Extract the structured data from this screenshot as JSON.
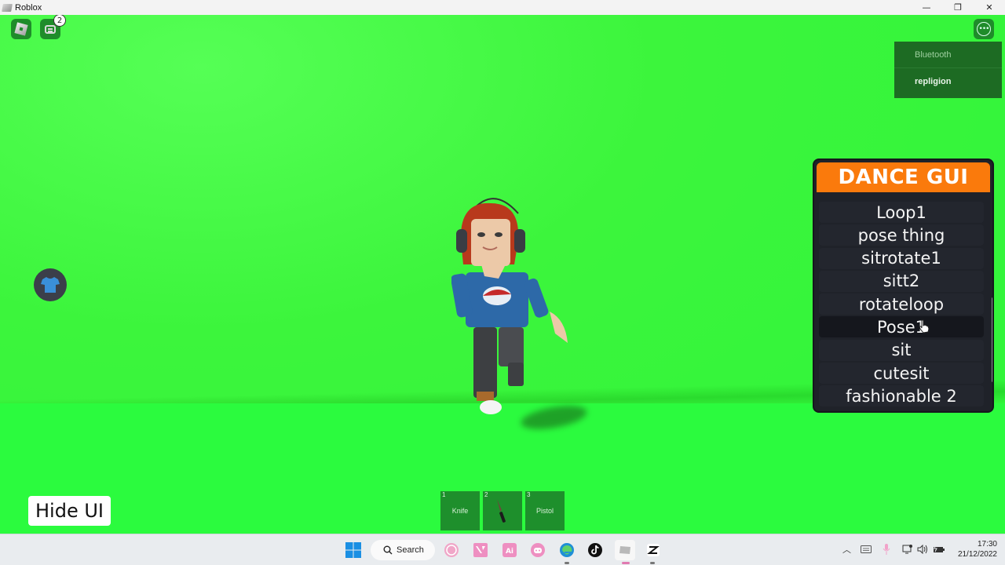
{
  "window": {
    "title": "Roblox",
    "controls": {
      "minimize": "—",
      "restore": "❐",
      "close": "✕"
    }
  },
  "topbar": {
    "chat_badge_count": "2",
    "menu_icon": "more-icon"
  },
  "dropdown": {
    "options": [
      {
        "label": "Bluetooth"
      },
      {
        "label": "repligion"
      }
    ]
  },
  "dance_gui": {
    "title": "DANCE GUI",
    "header_color": "#fa7a0c",
    "items": [
      {
        "label": "Loop1"
      },
      {
        "label": "pose thing"
      },
      {
        "label": "sitrotate1"
      },
      {
        "label": "sitt2"
      },
      {
        "label": "rotateloop"
      },
      {
        "label": "Pose1",
        "hovered": true
      },
      {
        "label": "sit"
      },
      {
        "label": "cutesit"
      },
      {
        "label": "fashionable 2"
      }
    ]
  },
  "hide_ui": {
    "label": "Hide UI"
  },
  "hotbar": {
    "slots": [
      {
        "number": "1",
        "label": "Knife"
      },
      {
        "number": "2",
        "label": "",
        "icon": "knife-icon"
      },
      {
        "number": "3",
        "label": "Pistol"
      }
    ]
  },
  "taskbar": {
    "search_label": "Search",
    "apps": [
      "start",
      "obs",
      "valorant",
      "illustrator",
      "discord",
      "edge",
      "tiktok",
      "roblox",
      "capcut"
    ],
    "clock": {
      "time": "17:30",
      "date": "21/12/2022"
    }
  }
}
